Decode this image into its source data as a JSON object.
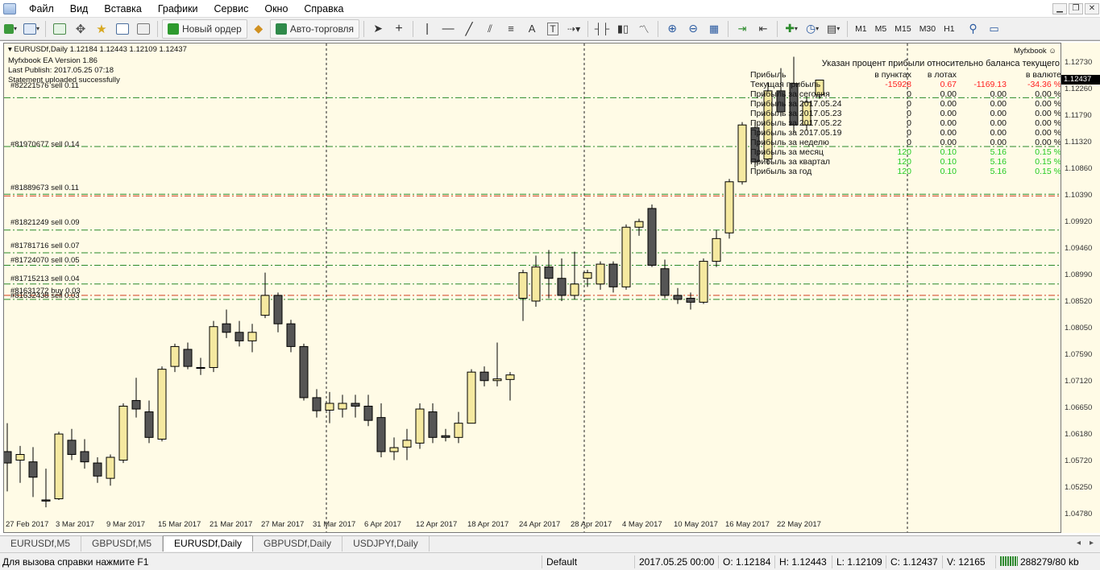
{
  "menubar": {
    "items": [
      "Файл",
      "Вид",
      "Вставка",
      "Графики",
      "Сервис",
      "Окно",
      "Справка"
    ]
  },
  "toolbar": {
    "new_order_label": "Новый ордер",
    "autotrading_label": "Авто-торговля",
    "timeframes": [
      "M1",
      "M5",
      "M15",
      "M30",
      "H1"
    ]
  },
  "chart": {
    "header": "EURUSDf,Daily  1.12184 1.12443 1.12109 1.12437",
    "ea_lines": [
      "Myfxbook EA Version 1.86",
      "Last Publish: 2017.05.25 07:18",
      "Statement uploaded successfully"
    ],
    "current_price": "1.12437",
    "price_ticks": [
      "1.12730",
      "1.12260",
      "1.11790",
      "1.11320",
      "1.10860",
      "1.10390",
      "1.09920",
      "1.09460",
      "1.08990",
      "1.08520",
      "1.08050",
      "1.07590",
      "1.07120",
      "1.06650",
      "1.06180",
      "1.05720",
      "1.05250",
      "1.04780"
    ],
    "date_labels": [
      "27 Feb 2017",
      "3 Mar 2017",
      "9 Mar 2017",
      "15 Mar 2017",
      "21 Mar 2017",
      "27 Mar 2017",
      "31 Mar 2017",
      "6 Apr 2017",
      "12 Apr 2017",
      "18 Apr 2017",
      "24 Apr 2017",
      "28 Apr 2017",
      "4 May 2017",
      "10 May 2017",
      "16 May 2017",
      "22 May 2017"
    ],
    "order_labels": [
      "#82221576 sell 0.11",
      "#81970677 sell 0.14",
      "#81889673 sell 0.11",
      "#81821249 sell 0.09",
      "#81781716 sell 0.07",
      "#81724070 sell 0.05",
      "#81715213 sell 0.04",
      "#81631272 buy 0.03",
      "#81632438 sell 0.03"
    ],
    "candles": [
      {
        "o": 1.059,
        "h": 1.064,
        "l": 1.052,
        "c": 1.057
      },
      {
        "o": 1.0575,
        "h": 1.06,
        "l": 1.0535,
        "c": 1.0585
      },
      {
        "o": 1.0572,
        "h": 1.0598,
        "l": 1.051,
        "c": 1.0545
      },
      {
        "o": 1.0505,
        "h": 1.056,
        "l": 1.0492,
        "c": 1.0503
      },
      {
        "o": 1.0507,
        "h": 1.0625,
        "l": 1.0505,
        "c": 1.0621
      },
      {
        "o": 1.061,
        "h": 1.063,
        "l": 1.0575,
        "c": 1.0585
      },
      {
        "o": 1.059,
        "h": 1.0612,
        "l": 1.056,
        "c": 1.0572
      },
      {
        "o": 1.057,
        "h": 1.058,
        "l": 1.0535,
        "c": 1.0547
      },
      {
        "o": 1.0543,
        "h": 1.0585,
        "l": 1.053,
        "c": 1.058
      },
      {
        "o": 1.0575,
        "h": 1.0675,
        "l": 1.057,
        "c": 1.067
      },
      {
        "o": 1.068,
        "h": 1.072,
        "l": 1.065,
        "c": 1.0665
      },
      {
        "o": 1.066,
        "h": 1.068,
        "l": 1.0605,
        "c": 1.0615
      },
      {
        "o": 1.0612,
        "h": 1.074,
        "l": 1.0608,
        "c": 1.0735
      },
      {
        "o": 1.074,
        "h": 1.078,
        "l": 1.073,
        "c": 1.0775
      },
      {
        "o": 1.077,
        "h": 1.0782,
        "l": 1.0735,
        "c": 1.074
      },
      {
        "o": 1.0738,
        "h": 1.0755,
        "l": 1.0725,
        "c": 1.0738
      },
      {
        "o": 1.0738,
        "h": 1.082,
        "l": 1.073,
        "c": 1.081
      },
      {
        "o": 1.0815,
        "h": 1.084,
        "l": 1.079,
        "c": 1.08
      },
      {
        "o": 1.08,
        "h": 1.082,
        "l": 1.0775,
        "c": 1.0785
      },
      {
        "o": 1.0785,
        "h": 1.0815,
        "l": 1.0765,
        "c": 1.08
      },
      {
        "o": 1.083,
        "h": 1.0905,
        "l": 1.0825,
        "c": 1.0865
      },
      {
        "o": 1.0865,
        "h": 1.087,
        "l": 1.08,
        "c": 1.0815
      },
      {
        "o": 1.0815,
        "h": 1.0822,
        "l": 1.0765,
        "c": 1.0775
      },
      {
        "o": 1.0775,
        "h": 1.078,
        "l": 1.068,
        "c": 1.0685
      },
      {
        "o": 1.0685,
        "h": 1.07,
        "l": 1.065,
        "c": 1.0662
      },
      {
        "o": 1.0663,
        "h": 1.0695,
        "l": 1.064,
        "c": 1.0675
      },
      {
        "o": 1.0665,
        "h": 1.069,
        "l": 1.065,
        "c": 1.0675
      },
      {
        "o": 1.0675,
        "h": 1.069,
        "l": 1.065,
        "c": 1.067
      },
      {
        "o": 1.067,
        "h": 1.069,
        "l": 1.0635,
        "c": 1.0645
      },
      {
        "o": 1.065,
        "h": 1.0675,
        "l": 1.058,
        "c": 1.059
      },
      {
        "o": 1.059,
        "h": 1.0615,
        "l": 1.0575,
        "c": 1.0597
      },
      {
        "o": 1.0598,
        "h": 1.063,
        "l": 1.0575,
        "c": 1.061
      },
      {
        "o": 1.0605,
        "h": 1.0675,
        "l": 1.0595,
        "c": 1.0665
      },
      {
        "o": 1.066,
        "h": 1.0675,
        "l": 1.0605,
        "c": 1.0615
      },
      {
        "o": 1.0618,
        "h": 1.063,
        "l": 1.0608,
        "c": 1.0615
      },
      {
        "o": 1.0615,
        "h": 1.066,
        "l": 1.0605,
        "c": 1.064
      },
      {
        "o": 1.064,
        "h": 1.0735,
        "l": 1.064,
        "c": 1.073
      },
      {
        "o": 1.073,
        "h": 1.074,
        "l": 1.0705,
        "c": 1.0715
      },
      {
        "o": 1.0715,
        "h": 1.0782,
        "l": 1.0705,
        "c": 1.0718
      },
      {
        "o": 1.0717,
        "h": 1.073,
        "l": 1.068,
        "c": 1.0725
      },
      {
        "o": 1.086,
        "h": 1.091,
        "l": 1.082,
        "c": 1.0905
      },
      {
        "o": 1.0855,
        "h": 1.0935,
        "l": 1.0845,
        "c": 1.0915
      },
      {
        "o": 1.0915,
        "h": 1.0945,
        "l": 1.086,
        "c": 1.0895
      },
      {
        "o": 1.0895,
        "h": 1.093,
        "l": 1.0855,
        "c": 1.0865
      },
      {
        "o": 1.0865,
        "h": 1.0942,
        "l": 1.0858,
        "c": 1.0885
      },
      {
        "o": 1.0895,
        "h": 1.091,
        "l": 1.088,
        "c": 1.0905
      },
      {
        "o": 1.0885,
        "h": 1.0925,
        "l": 1.0875,
        "c": 1.092
      },
      {
        "o": 1.092,
        "h": 1.0925,
        "l": 1.087,
        "c": 1.088
      },
      {
        "o": 1.088,
        "h": 1.099,
        "l": 1.0875,
        "c": 1.0985
      },
      {
        "o": 1.0985,
        "h": 1.1,
        "l": 1.097,
        "c": 1.0995
      },
      {
        "o": 1.1018,
        "h": 1.1025,
        "l": 1.0915,
        "c": 1.0918
      },
      {
        "o": 1.0912,
        "h": 1.0928,
        "l": 1.086,
        "c": 1.0865
      },
      {
        "o": 1.0865,
        "h": 1.0878,
        "l": 1.085,
        "c": 1.0858
      },
      {
        "o": 1.086,
        "h": 1.087,
        "l": 1.084,
        "c": 1.0853
      },
      {
        "o": 1.0853,
        "h": 1.093,
        "l": 1.085,
        "c": 1.0925
      },
      {
        "o": 1.0925,
        "h": 1.098,
        "l": 1.0915,
        "c": 1.0965
      },
      {
        "o": 1.0975,
        "h": 1.107,
        "l": 1.0965,
        "c": 1.1065
      },
      {
        "o": 1.1065,
        "h": 1.117,
        "l": 1.106,
        "c": 1.1165
      },
      {
        "o": 1.116,
        "h": 1.117,
        "l": 1.109,
        "c": 1.11
      },
      {
        "o": 1.1105,
        "h": 1.124,
        "l": 1.1095,
        "c": 1.1225
      },
      {
        "o": 1.1225,
        "h": 1.1265,
        "l": 1.118,
        "c": 1.1188
      },
      {
        "o": 1.1238,
        "h": 1.1285,
        "l": 1.115,
        "c": 1.1165
      },
      {
        "o": 1.1165,
        "h": 1.1215,
        "l": 1.1155,
        "c": 1.1205
      },
      {
        "o": 1.1218,
        "h": 1.1244,
        "l": 1.1211,
        "c": 1.1244
      }
    ]
  },
  "myfxbook": {
    "title": "Myfxbook",
    "header_lines": [
      "Указан процент прибыли относительно баланса текущего",
      "в валюте"
    ],
    "columns": [
      "в пунктах",
      "в лотах"
    ],
    "label_title": "Прибыль",
    "rows": [
      {
        "label": "Текущая прибыль",
        "pts": "-15928",
        "lots": "0.67",
        "money": "-1169.13",
        "pct": "-34.36 %"
      },
      {
        "label": "Прибыль за сегодня",
        "pts": "0",
        "lots": "0.00",
        "money": "0.00",
        "pct": "0.00 %"
      },
      {
        "label": "Прибыль за 2017.05.24",
        "pts": "0",
        "lots": "0.00",
        "money": "0.00",
        "pct": "0.00 %"
      },
      {
        "label": "Прибыль за 2017.05.23",
        "pts": "0",
        "lots": "0.00",
        "money": "0.00",
        "pct": "0.00 %"
      },
      {
        "label": "Прибыль за 2017.05.22",
        "pts": "0",
        "lots": "0.00",
        "money": "0.00",
        "pct": "0.00 %"
      },
      {
        "label": "Прибыль за 2017.05.19",
        "pts": "0",
        "lots": "0.00",
        "money": "0.00",
        "pct": "0.00 %"
      },
      {
        "label": "Прибыль за неделю",
        "pts": "0",
        "lots": "0.00",
        "money": "0.00",
        "pct": "0.00 %"
      },
      {
        "label": "Прибыль за месяц",
        "pts": "120",
        "lots": "0.10",
        "money": "5.16",
        "pct": "0.15 %"
      },
      {
        "label": "Прибыль за квартал",
        "pts": "120",
        "lots": "0.10",
        "money": "5.16",
        "pct": "0.15 %"
      },
      {
        "label": "Прибыль за год",
        "pts": "120",
        "lots": "0.10",
        "money": "5.16",
        "pct": "0.15 %"
      }
    ],
    "colors": {
      "negative": "#ff2020",
      "positive": "#22cc22",
      "neutral": "#111111"
    }
  },
  "tabs": [
    "EURUSDf,M5",
    "GBPUSDf,M5",
    "EURUSDf,Daily",
    "GBPUSDf,Daily",
    "USDJPYf,Daily"
  ],
  "active_tab": "EURUSDf,Daily",
  "status": {
    "help": "Для вызова справки нажмите F1",
    "profile": "Default",
    "datetime": "2017.05.25 00:00",
    "open": "O: 1.12184",
    "high": "H: 1.12443",
    "low": "L: 1.12109",
    "close": "C: 1.12437",
    "volume": "V: 12165",
    "traffic": "288279/80 kb"
  },
  "colors": {
    "chart_bg": "#fffbe6",
    "bull_body": "#f5e9a0",
    "bear_body": "#555555",
    "sell_line": "#2a8a2a",
    "buy_line": "#d04020"
  }
}
